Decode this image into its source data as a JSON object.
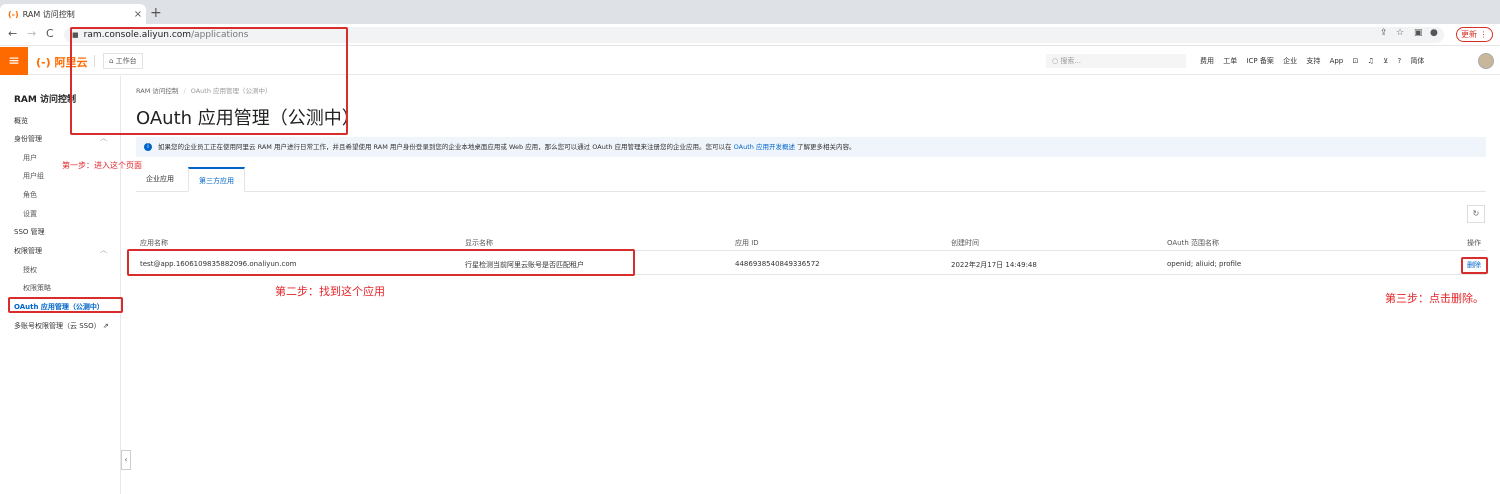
{
  "browser": {
    "tab_title": "RAM 访问控制",
    "tab_favicon": "(-)",
    "tab_close": "×",
    "new_tab": "+",
    "url_host": "ram.console.aliyun.com",
    "url_path": "/applications",
    "update_label": "更新",
    "back": "←",
    "forward": "→",
    "reload": "C"
  },
  "topbar": {
    "menu_icon": "≡",
    "logo_text": "(-) 阿里云",
    "workbench_label": "工作台",
    "search_placeholder": "搜索...",
    "links": [
      "费用",
      "工单",
      "ICP 备案",
      "企业",
      "支持",
      "App"
    ],
    "language": "简体"
  },
  "sidebar": {
    "title": "RAM 访问控制",
    "items": [
      {
        "label": "概览"
      },
      {
        "label": "身份管理"
      },
      {
        "label": "用户"
      },
      {
        "label": "用户组"
      },
      {
        "label": "角色"
      },
      {
        "label": "设置"
      },
      {
        "label": "SSO 管理"
      },
      {
        "label": "权限管理"
      },
      {
        "label": "授权"
      },
      {
        "label": "权限策略"
      },
      {
        "label": "OAuth 应用管理（公测中）"
      },
      {
        "label": "多账号权限管理（云 SSO）"
      }
    ]
  },
  "breadcrumb": {
    "root": "RAM 访问控制",
    "sep": "/",
    "current": "OAuth 应用管理（公测中）"
  },
  "page_title": "OAuth 应用管理（公测中）",
  "notice": {
    "text": "如果您的企业员工正在使用阿里云 RAM 用户进行日常工作，并且希望使用 RAM 用户身份登录到您的企业本地桌面应用或 Web 应用，那么您可以通过 OAuth 应用管理来注册您的企业应用。您可以在",
    "link": "OAuth 应用开发概述",
    "suffix": "了解更多相关内容。"
  },
  "tabs": [
    {
      "label": "企业应用"
    },
    {
      "label": "第三方应用"
    }
  ],
  "table": {
    "headers": [
      "应用名称",
      "显示名称",
      "应用 ID",
      "创建时间",
      "OAuth 范围名称",
      "操作"
    ],
    "rows": [
      {
        "name": "test@app.1606109835882096.onaliyun.com",
        "display_name": "行星检测当前阿里云账号是否匹配租户",
        "app_id": "4486938540849336572",
        "created": "2022年2月17日 14:49:48",
        "scopes": "openid; aliuid; profile",
        "action": "删除"
      }
    ]
  },
  "annotations": {
    "step1": "第一步：进入这个页面",
    "step2": "第二步：找到这个应用",
    "step3": "第三步：点击删除。"
  },
  "colors": {
    "brand": "#ff6a00",
    "link": "#0064c8",
    "annotation": "#d92c2c"
  }
}
